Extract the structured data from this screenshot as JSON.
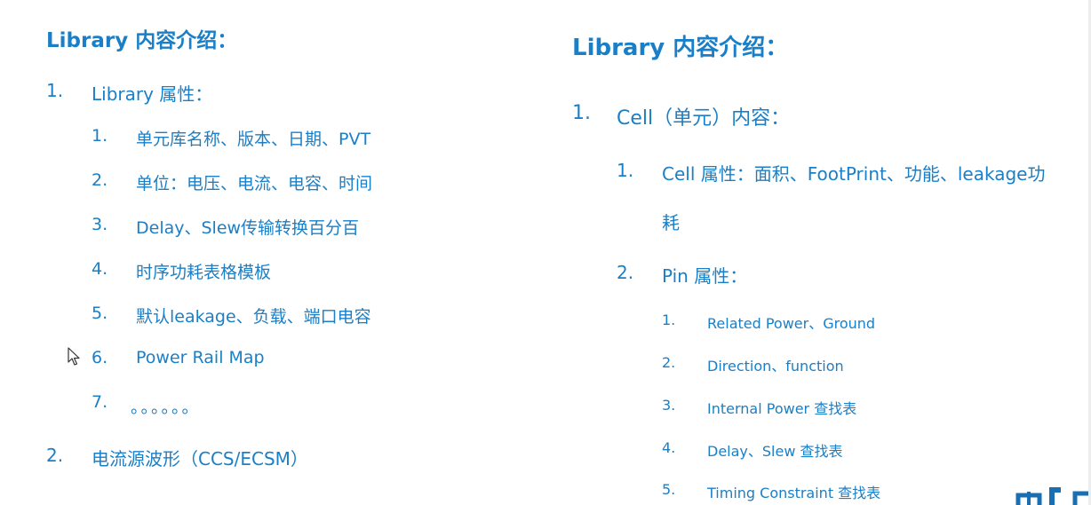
{
  "left": {
    "title": "Library 内容介绍：",
    "items": [
      {
        "num": "1.",
        "label": "Library 属性："
      },
      {
        "num": "1.",
        "label": "单元库名称、版本、日期、PVT"
      },
      {
        "num": "2.",
        "label": "单位：电压、电流、电容、时间"
      },
      {
        "num": "3.",
        "label": "Delay、Slew传输转换百分百"
      },
      {
        "num": "4.",
        "label": "时序功耗表格模板"
      },
      {
        "num": "5.",
        "label": "默认leakage、负载、端口电容"
      },
      {
        "num": "6.",
        "label": "Power Rail Map"
      },
      {
        "num": "7.",
        "label": "。。。。。。"
      },
      {
        "num": "2.",
        "label": "电流源波形（CCS/ECSM）"
      }
    ]
  },
  "right": {
    "title": "Library 内容介绍：",
    "items": [
      {
        "num": "1.",
        "label": "Cell（单元）内容："
      },
      {
        "num": "1.",
        "label": "Cell 属性：面积、FootPrint、功能、leakage功"
      },
      {
        "num": "",
        "label": "耗"
      },
      {
        "num": "2.",
        "label": "Pin 属性："
      },
      {
        "num": "1.",
        "label": "Related Power、Ground"
      },
      {
        "num": "2.",
        "label": "Direction、function"
      },
      {
        "num": "3.",
        "label": "Internal Power 查找表"
      },
      {
        "num": "4.",
        "label": "Delay、Slew 查找表"
      },
      {
        "num": "5.",
        "label": "Timing Constraint 查找表"
      }
    ]
  },
  "colors": {
    "text": "#1a7fc7",
    "logo": "#1a6fb3"
  },
  "icons": {
    "cursor": "mouse-pointer-icon",
    "logo": "brand-logo-icon"
  }
}
